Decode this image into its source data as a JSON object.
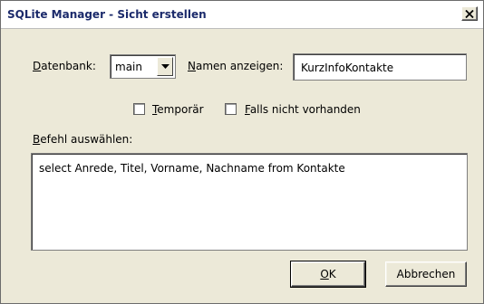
{
  "window": {
    "title": "SQLite Manager - Sicht erstellen"
  },
  "database": {
    "label_u": "D",
    "label_rest": "atenbank:",
    "selected": "main"
  },
  "name": {
    "label_u": "N",
    "label_rest": "amen anzeigen:",
    "value": "KurzInfoKontakte"
  },
  "options": {
    "temporary": {
      "label_u": "T",
      "label_rest": "emporär",
      "checked": false
    },
    "if_not_exists": {
      "label_u": "F",
      "label_rest": "alls nicht vorhanden",
      "checked": false
    }
  },
  "statement": {
    "label_u": "B",
    "label_rest": "efehl auswählen:",
    "value": "select Anrede, Titel, Vorname, Nachname from Kontakte"
  },
  "buttons": {
    "ok_u": "O",
    "ok_rest": "K",
    "cancel": "Abbrechen"
  },
  "icons": {
    "close": "close-icon",
    "dropdown": "chevron-down-icon"
  },
  "colors": {
    "dialog_bg": "#ece9d8",
    "title_text": "#1b2a6b"
  }
}
